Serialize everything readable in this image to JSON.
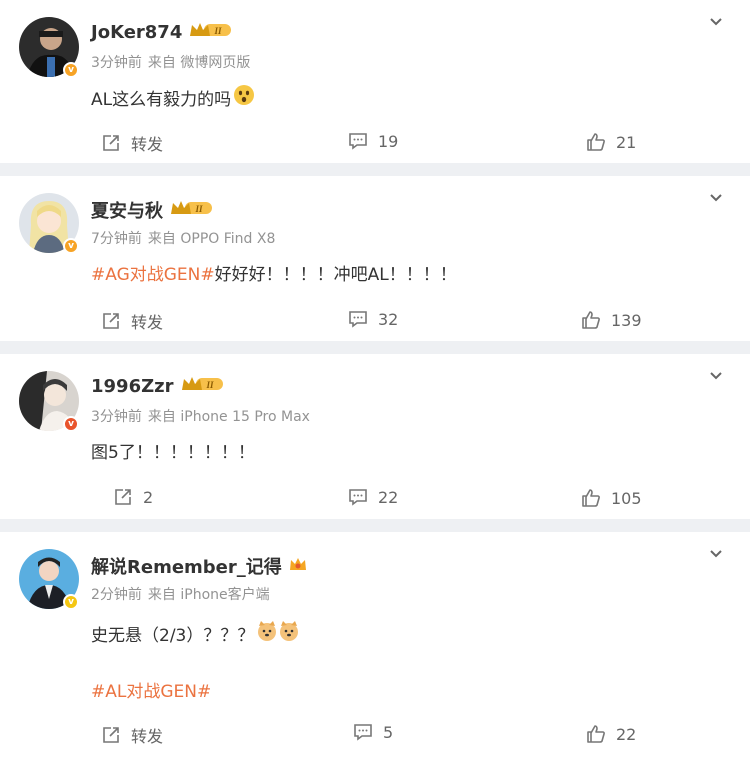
{
  "posts": [
    {
      "username": "JoKer874",
      "level": "II",
      "time": "3分钟前",
      "source": "来自 微博网页版",
      "text": "AL这么有毅力的吗",
      "repost": "转发",
      "comments": "19",
      "likes": "21",
      "badge_color": "#f7a325"
    },
    {
      "username": "夏安与秋",
      "level": "II",
      "time": "7分钟前",
      "source": "来自 OPPO Find X8",
      "topic": "#AG对战GEN#",
      "text": "好好好！！！！冲吧AL！！！！",
      "repost": "转发",
      "comments": "32",
      "likes": "139",
      "badge_color": "#f7a325"
    },
    {
      "username": "1996Zzr",
      "level": "II",
      "time": "3分钟前",
      "source": "来自 iPhone 15 Pro Max",
      "text": "图5了！！！！！！！",
      "repost": "2",
      "comments": "22",
      "likes": "105",
      "badge_color": "#e9542c"
    },
    {
      "username": "解说Remember_记得",
      "time": "2分钟前",
      "source": "来自 iPhone客户端",
      "text": "史无悬（2/3）？？？",
      "topic": "#AL对战GEN#",
      "repost": "转发",
      "comments": "5",
      "likes": "22",
      "badge_color": "#f4c613"
    }
  ],
  "icons": {
    "repost": "share-icon",
    "comment": "comment-icon",
    "like": "thumbs-up-icon",
    "more": "chevron-down-icon"
  }
}
